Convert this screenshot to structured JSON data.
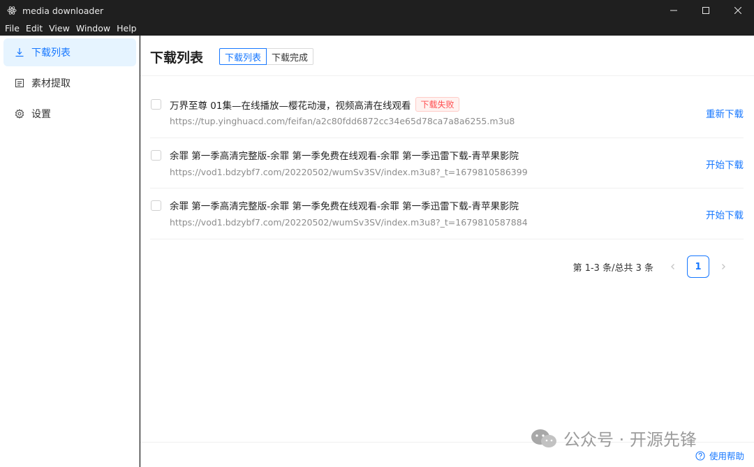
{
  "window": {
    "title": "media downloader",
    "icon": "electron-icon",
    "controls": [
      "minimize-icon",
      "maximize-icon",
      "close-icon"
    ]
  },
  "menubar": {
    "items": [
      "File",
      "Edit",
      "View",
      "Window",
      "Help"
    ]
  },
  "sidebar": {
    "items": [
      {
        "label": "下载列表",
        "icon": "download-icon",
        "active": true
      },
      {
        "label": "素材提取",
        "icon": "document-icon",
        "active": false
      },
      {
        "label": "设置",
        "icon": "gear-icon",
        "active": false
      }
    ]
  },
  "main": {
    "title": "下载列表",
    "tabs": [
      {
        "label": "下载列表",
        "active": true
      },
      {
        "label": "下载完成",
        "active": false
      }
    ],
    "rows": [
      {
        "title": "万界至尊 01集—在线播放—樱花动漫，视频高清在线观看",
        "badge": "下载失败",
        "url": "https://tup.yinghuacd.com/feifan/a2c80fdd6872cc34e65d78ca7a8a6255.m3u8",
        "action": "重新下载"
      },
      {
        "title": "余罪 第一季高清完整版-余罪 第一季免费在线观看-余罪 第一季迅雷下载-青苹果影院",
        "badge": "",
        "url": "https://vod1.bdzybf7.com/20220502/wumSv3SV/index.m3u8?_t=1679810586399",
        "action": "开始下载"
      },
      {
        "title": "余罪 第一季高清完整版-余罪 第一季免费在线观看-余罪 第一季迅雷下载-青苹果影院",
        "badge": "",
        "url": "https://vod1.bdzybf7.com/20220502/wumSv3SV/index.m3u8?_t=1679810587884",
        "action": "开始下载"
      }
    ],
    "pagination": {
      "total_text": "第 1-3 条/总共 3 条",
      "current_page": "1"
    }
  },
  "footer": {
    "watermark": "公众号 · 开源先锋",
    "help_label": "使用帮助"
  },
  "colors": {
    "accent": "#1677ff",
    "danger": "#ff4d4f",
    "titlebar": "#1f1f1f",
    "active_nav_bg": "#e6f4ff"
  }
}
